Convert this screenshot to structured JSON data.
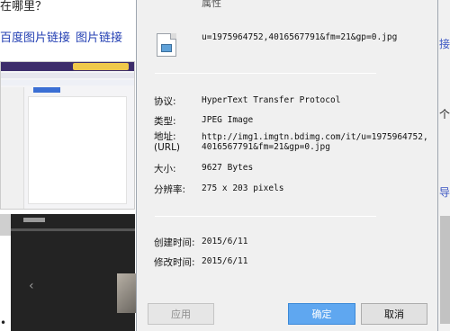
{
  "background": {
    "top_text": "在哪里？",
    "links": [
      "百度图片链接",
      "图片链接"
    ],
    "bullet": "•",
    "right_edge_chars": [
      "接",
      "个",
      "导"
    ]
  },
  "dialog": {
    "title": "属性",
    "file_name": "u=1975964752,4016567791&fm=21&gp=0.jpg",
    "properties": {
      "protocol_label": "协议:",
      "protocol_value": "HyperText Transfer Protocol",
      "type_label": "类型:",
      "type_value": "JPEG Image",
      "address_label": "地址:",
      "address_label_sub": "(URL)",
      "address_value_line1": "http://img1.imgtn.bdimg.com/it/u=1975964752,",
      "address_value_line2": "4016567791&fm=21&gp=0.jpg",
      "size_label": "大小:",
      "size_value": "9627 Bytes",
      "resolution_label": "分辨率:",
      "resolution_value": "275 x 203 pixels"
    },
    "dates": {
      "created_label": "创建时间:",
      "created_value": "2015/6/11",
      "modified_label": "修改时间:",
      "modified_value": "2015/6/11"
    },
    "buttons": {
      "apply": "应用",
      "ok": "确定",
      "cancel": "取消"
    }
  }
}
